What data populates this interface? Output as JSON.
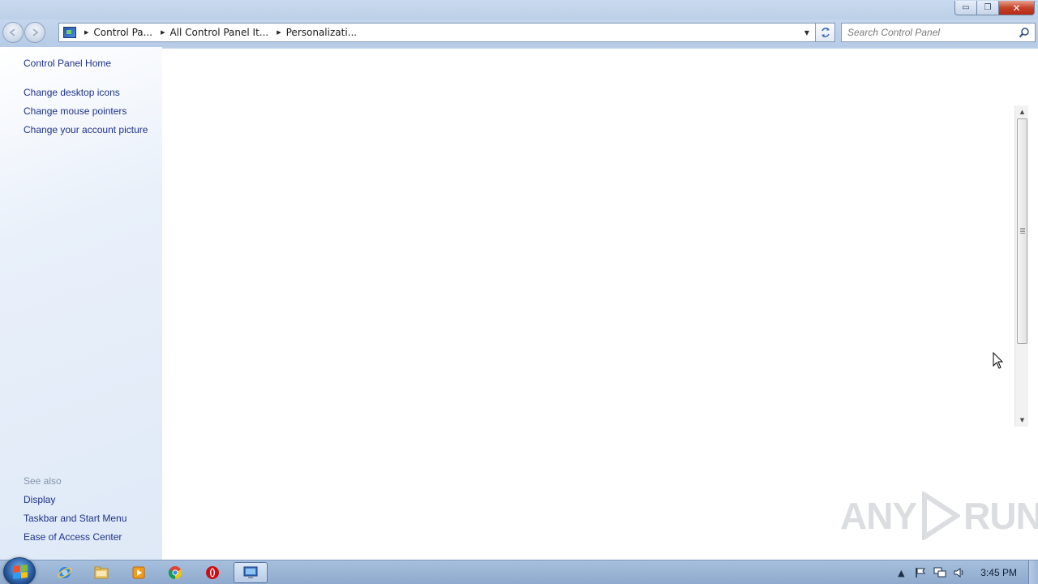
{
  "window": {
    "controls": {
      "minimize": "▭",
      "maximize": "❐",
      "close": "✕"
    }
  },
  "navigation": {
    "back_icon": "back-arrow-icon",
    "forward_icon": "forward-arrow-icon",
    "breadcrumbs": [
      "Control Pa...",
      "All Control Panel It...",
      "Personalizati..."
    ],
    "search_placeholder": "Search Control Panel"
  },
  "left_pane": {
    "home_link": "Control Panel Home",
    "task_links": [
      "Change desktop icons",
      "Change mouse pointers",
      "Change your account picture"
    ],
    "see_also_heading": "See also",
    "see_also_links": [
      "Display",
      "Taskbar and Start Menu",
      "Ease of Access Center"
    ]
  },
  "watermark": {
    "left": "ANY",
    "right": "RUN"
  },
  "taskbar": {
    "pinned": [
      "internet-explorer-icon",
      "windows-explorer-icon",
      "media-player-icon",
      "chrome-icon",
      "opera-icon",
      "control-panel-icon"
    ],
    "clock": "3:45 PM"
  },
  "colors": {
    "link": "#1e3287",
    "heading": "#8595ab",
    "close": "#c6432a"
  }
}
